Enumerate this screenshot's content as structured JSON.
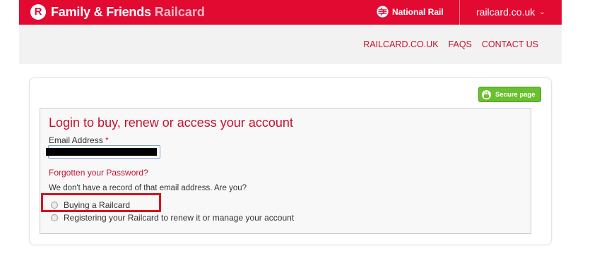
{
  "header": {
    "brand_mark": "R",
    "brand_primary": "Family & Friends",
    "brand_secondary": "Railcard",
    "partner": "National Rail",
    "site_menu": "railcard.co.uk",
    "site_menu_icon": "chevron-down-icon"
  },
  "subnav": {
    "links": [
      "RAILCARD.CO.UK",
      "FAQS",
      "CONTACT US"
    ]
  },
  "secure_badge": {
    "label": "Secure page",
    "icon": "lock-icon"
  },
  "login": {
    "heading": "Login to buy, renew or access your account",
    "email_label": "Email Address",
    "required_marker": "*",
    "email_value": "",
    "forgot_link": "Forgotten your Password?",
    "notice": "We don't have a record of that email address. Are you?",
    "options": [
      "Buying a Railcard",
      "Registering your Railcard to renew it or manage your account"
    ]
  },
  "colors": {
    "brand_red": "#e30a32",
    "link_red": "#c8102e",
    "secure_green": "#6ac12f",
    "highlight_red": "#d8141e"
  }
}
